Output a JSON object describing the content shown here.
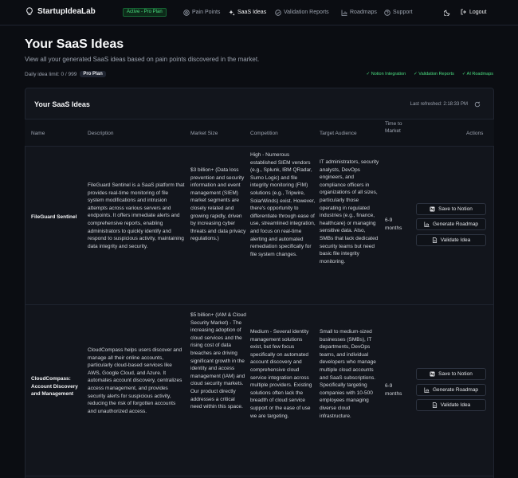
{
  "nav": {
    "app_name": "StartupIdeaLab",
    "plan_badge": "Active - Pro Plan",
    "links": [
      {
        "label": "Pain Points"
      },
      {
        "label": "SaaS Ideas"
      },
      {
        "label": "Validation Reports"
      },
      {
        "label": "Roadmaps"
      },
      {
        "label": "Support"
      }
    ],
    "logout": "Logout"
  },
  "header": {
    "title": "Your SaaS Ideas",
    "subtitle": "View all your generated SaaS ideas based on pain points discovered in the market.",
    "limit_text": "Daily idea limit: 0 / 999",
    "plan_pill": "Pro Plan",
    "features": [
      "✓ Notion Integration",
      "✓ Validation Reports",
      "✓ AI Roadmaps"
    ]
  },
  "card": {
    "title": "Your SaaS Ideas",
    "refreshed": "Last refreshed: 2:18:33 PM"
  },
  "table": {
    "headers": {
      "name": "Name",
      "description": "Description",
      "market": "Market Size",
      "competition": "Competition",
      "audience": "Target Audience",
      "time": "Time to Market",
      "actions": "Actions"
    },
    "rows": [
      {
        "name": "FileGuard Sentinel",
        "description": "FileGuard Sentinel is a SaaS platform that provides real-time monitoring of file system modifications and intrusion attempts across various servers and endpoints. It offers immediate alerts and comprehensive reports, enabling administrators to quickly identify and respond to suspicious activity, maintaining data integrity and security.",
        "market": "$3 billion+ (Data loss prevention and security information and event management (SIEM) market segments are closely related and growing rapidly, driven by increasing cyber threats and data privacy regulations.)",
        "competition": "High - Numerous established SIEM vendors (e.g., Splunk, IBM QRadar, Sumo Logic) and file integrity monitoring (FIM) solutions (e.g., Tripwire, SolarWinds) exist. However, there's opportunity to differentiate through ease of use, streamlined integration, and focus on real-time alerting and automated remediation specifically for file system changes.",
        "audience": "IT administrators, security analysts, DevOps engineers, and compliance officers in organizations of all sizes, particularly those operating in regulated industries (e.g., finance, healthcare) or managing sensitive data. Also, SMBs that lack dedicated security teams but need basic file integrity monitoring.",
        "time": "6-9 months"
      },
      {
        "name": "CloudCompass: Account Discovery and Management",
        "description": "CloudCompass helps users discover and manage all their online accounts, particularly cloud-based services like AWS, Google Cloud, and Azure. It automates account discovery, centralizes access management, and provides security alerts for suspicious activity, reducing the risk of forgotten accounts and unauthorized access.",
        "market": "$5 billion+ (IAM & Cloud Security Market) - The increasing adoption of cloud services and the rising cost of data breaches are driving significant growth in the identity and access management (IAM) and cloud security markets. Our product directly addresses a critical need within this space.",
        "competition": "Medium - Several identity management solutions exist, but few focus specifically on automated account discovery and comprehensive cloud service integration across multiple providers. Existing solutions often lack the breadth of cloud service support or the ease of use we are targeting.",
        "audience": "Small to medium-sized businesses (SMBs), IT departments, DevOps teams, and individual developers who manage multiple cloud accounts and SaaS subscriptions. Specifically targeting companies with 10-500 employees managing diverse cloud infrastructure.",
        "time": "6-9 months"
      }
    ],
    "actions": {
      "notion": "Save to Notion",
      "roadmap": "Generate Roadmap",
      "validate": "Validate Idea"
    }
  }
}
